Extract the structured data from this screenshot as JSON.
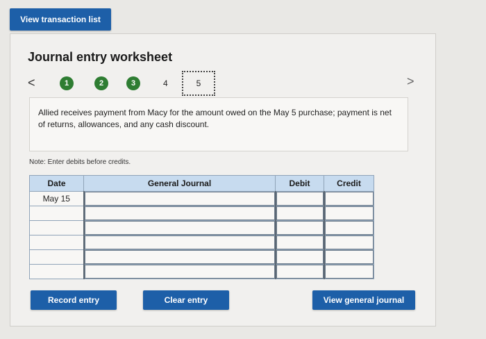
{
  "top_button": {
    "label": "View transaction list"
  },
  "worksheet": {
    "title": "Journal entry worksheet",
    "prev_arrow": "<",
    "next_arrow": ">",
    "steps": [
      "1",
      "2",
      "3",
      "4",
      "5"
    ],
    "current_step": "5",
    "description": "Allied receives payment from Macy for the amount owed on the May 5 purchase; payment is net of returns, allowances, and any cash discount.",
    "note": "Note: Enter debits before credits."
  },
  "table": {
    "headers": {
      "date": "Date",
      "general_journal": "General Journal",
      "debit": "Debit",
      "credit": "Credit"
    },
    "rows": [
      {
        "date": "May 15",
        "account": "",
        "debit": "",
        "credit": ""
      },
      {
        "date": "",
        "account": "",
        "debit": "",
        "credit": ""
      },
      {
        "date": "",
        "account": "",
        "debit": "",
        "credit": ""
      },
      {
        "date": "",
        "account": "",
        "debit": "",
        "credit": ""
      },
      {
        "date": "",
        "account": "",
        "debit": "",
        "credit": ""
      },
      {
        "date": "",
        "account": "",
        "debit": "",
        "credit": ""
      }
    ]
  },
  "actions": {
    "record": "Record entry",
    "clear": "Clear entry",
    "view_journal": "View general journal"
  },
  "colors": {
    "primary_button": "#1d5fa8",
    "step_complete": "#2e7d32",
    "table_header": "#c7dbef"
  }
}
